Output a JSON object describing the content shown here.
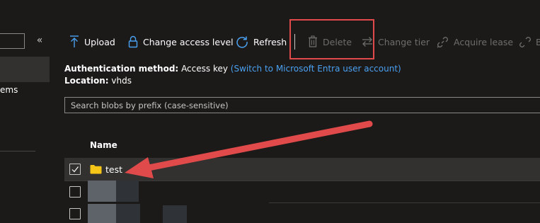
{
  "toolbar": {
    "upload_label": "Upload",
    "change_access_label": "Change access level",
    "refresh_label": "Refresh",
    "delete_label": "Delete",
    "change_tier_label": "Change tier",
    "acquire_lease_label": "Acquire lease",
    "break_lease_label": "B"
  },
  "sidebar": {
    "collapse_glyph": "«",
    "partial_item_label": "ems"
  },
  "info": {
    "auth_label": "Authentication method:",
    "auth_value": "Access key",
    "auth_link": "(Switch to Microsoft Entra user account)",
    "location_label": "Location:",
    "location_value": "vhds"
  },
  "search": {
    "placeholder": "Search blobs by prefix (case-sensitive)",
    "value": ""
  },
  "table": {
    "column_name": "Name",
    "rows": [
      {
        "name": "test",
        "checked": true,
        "type": "folder"
      },
      {
        "name": "",
        "checked": false,
        "type": "blurred"
      },
      {
        "name": "",
        "checked": false,
        "type": "blurred"
      }
    ]
  },
  "colors": {
    "background": "#1b1a19",
    "selected_row": "#323130",
    "link": "#4aa0f0",
    "annotation_red": "#e14a4a",
    "folder_yellow": "#f5c518"
  }
}
